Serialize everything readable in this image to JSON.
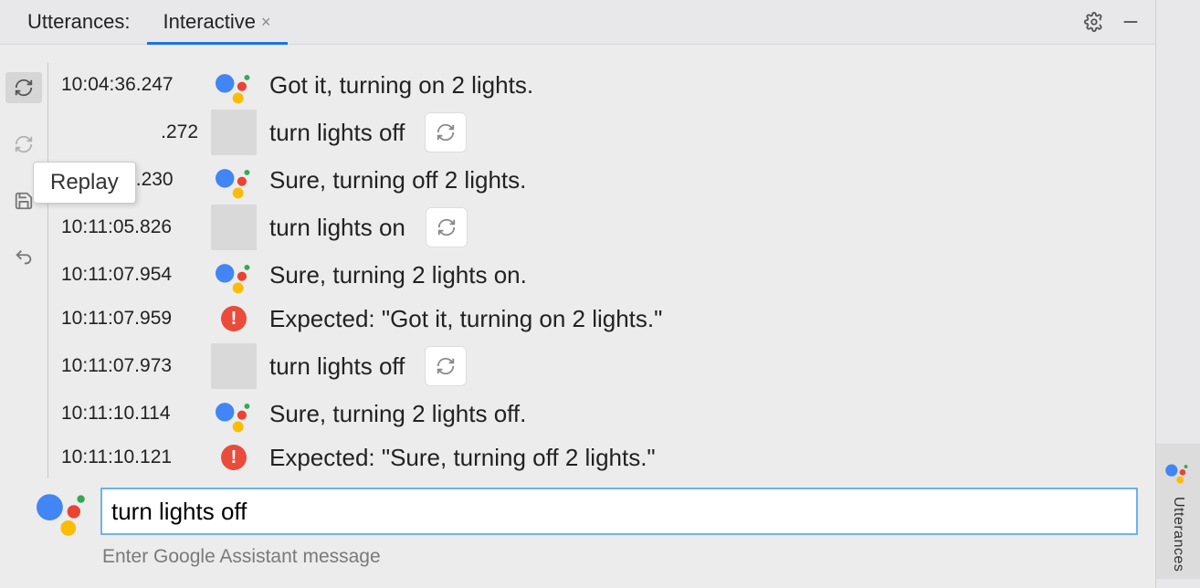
{
  "tabs": {
    "title": "Utterances:",
    "active": "Interactive"
  },
  "tooltip": "Replay",
  "log": [
    {
      "ts": "10:04:36.247",
      "actor": "assistant",
      "text": "Got it, turning on 2 lights."
    },
    {
      "ts": ".272",
      "actor": "user",
      "text": "turn lights off",
      "reload": true,
      "partial": true
    },
    {
      "ts": "10:06:55.230",
      "actor": "assistant",
      "text": "Sure, turning off 2 lights."
    },
    {
      "ts": "10:11:05.826",
      "actor": "user",
      "text": "turn lights on",
      "reload": true
    },
    {
      "ts": "10:11:07.954",
      "actor": "assistant",
      "text": "Sure, turning 2 lights on."
    },
    {
      "ts": "10:11:07.959",
      "actor": "error",
      "text": "Expected: \"Got it, turning on 2 lights.\""
    },
    {
      "ts": "10:11:07.973",
      "actor": "user",
      "text": "turn lights off",
      "reload": true
    },
    {
      "ts": "10:11:10.114",
      "actor": "assistant",
      "text": "Sure, turning 2 lights off."
    },
    {
      "ts": "10:11:10.121",
      "actor": "error",
      "text": "Expected: \"Sure, turning off 2 lights.\""
    }
  ],
  "input": {
    "value": "turn lights off",
    "placeholder": "",
    "hint": "Enter Google Assistant message"
  },
  "side_tab": "Utterances"
}
